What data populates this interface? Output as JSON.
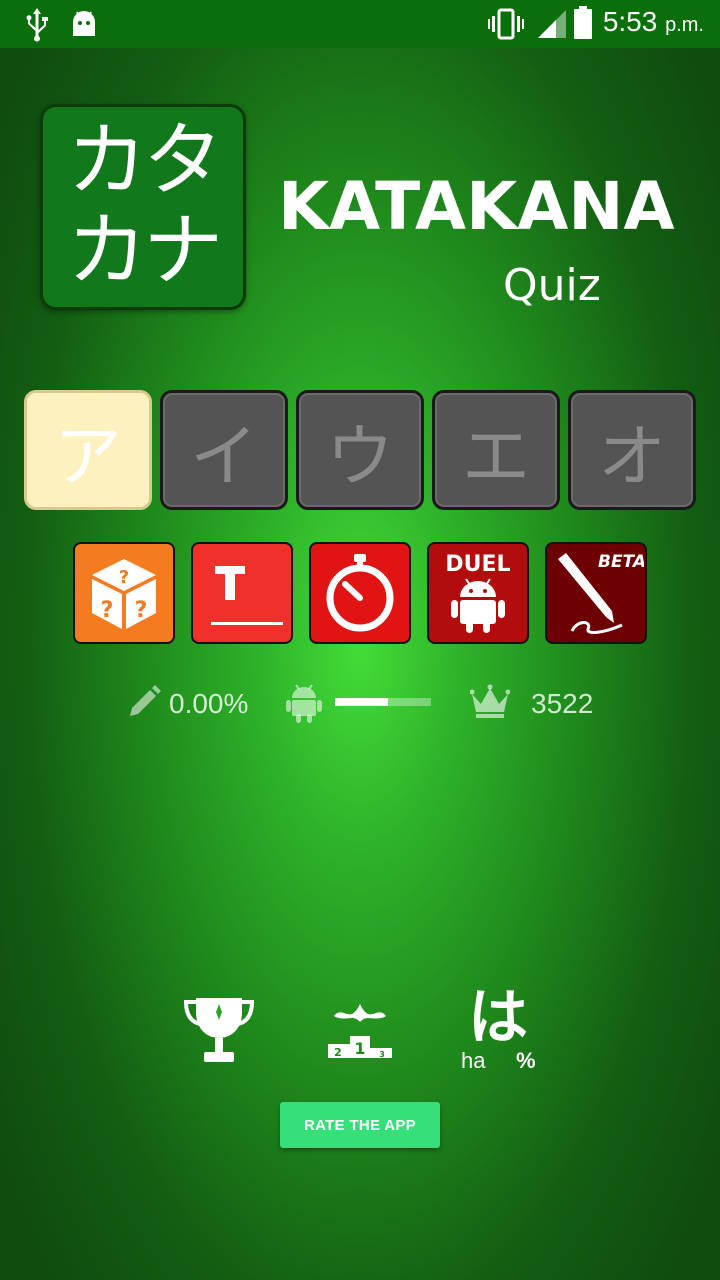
{
  "status_bar": {
    "time": "5:53",
    "ampm": "p.m.",
    "icons": [
      "usb-icon",
      "android-notification-icon",
      "vibrate-icon",
      "signal-icon",
      "battery-icon"
    ]
  },
  "header": {
    "logo_line1": "カタ",
    "logo_line2": "カナ",
    "title": "KATAKANA",
    "subtitle": "Quiz"
  },
  "kana_tabs": [
    {
      "label": "ア",
      "active": true
    },
    {
      "label": "イ",
      "active": false
    },
    {
      "label": "ウ",
      "active": false
    },
    {
      "label": "エ",
      "active": false
    },
    {
      "label": "オ",
      "active": false
    }
  ],
  "modes": [
    {
      "name": "random",
      "icon": "dice-icon",
      "color": "#f47b20"
    },
    {
      "name": "type",
      "icon": "text-t-icon",
      "color": "#f0302a"
    },
    {
      "name": "timed",
      "icon": "stopwatch-icon",
      "color": "#e11414"
    },
    {
      "name": "duel",
      "label": "DUEL",
      "icon": "android-icon",
      "color": "#b20c0c"
    },
    {
      "name": "write",
      "label": "BETA",
      "icon": "pen-icon",
      "color": "#6d0000"
    }
  ],
  "stats": {
    "accuracy": "0.00%",
    "progress_fraction": 0.55,
    "high_score": "3522"
  },
  "bottom": {
    "icons": [
      "trophy-icon",
      "leaderboard-podium-icon",
      "hiragana-stats-icon"
    ],
    "podium_labels": [
      "2",
      "1",
      "3"
    ],
    "hiragana_char": "は",
    "hiragana_romaji": "ha",
    "hiragana_percent": "%"
  },
  "rate_button": "RATE THE APP"
}
